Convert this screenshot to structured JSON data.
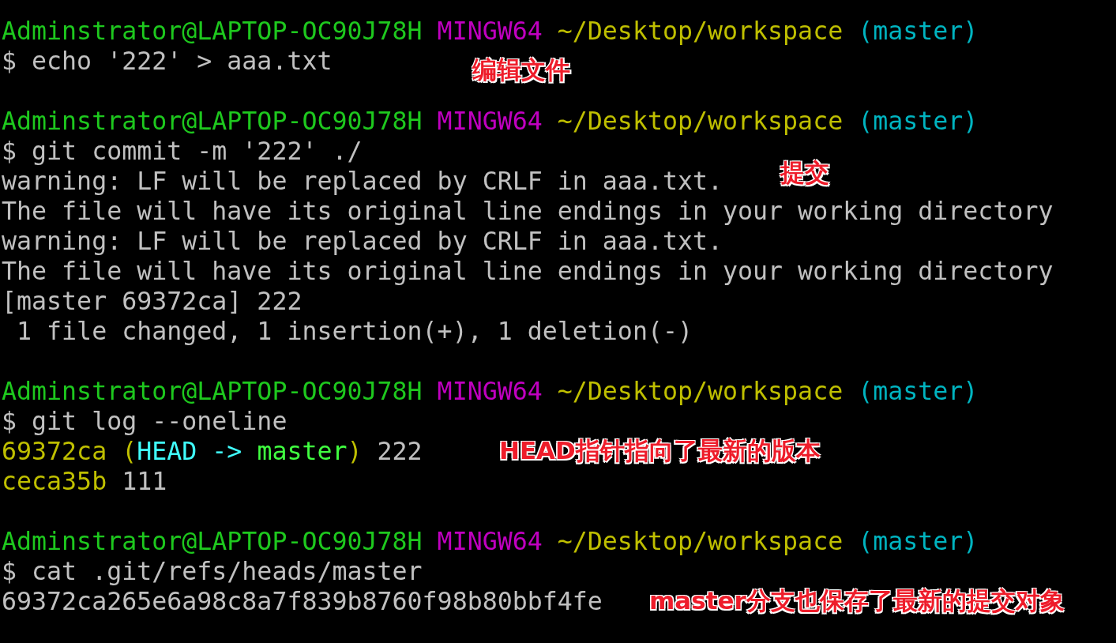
{
  "terminal": {
    "blocks": [
      {
        "lines": [
          {
            "segments": [
              {
                "kind": "user",
                "text": "Adminstrator@LAPTOP-OC90J78H"
              },
              {
                "kind": "host",
                "text": " MINGW64"
              },
              {
                "kind": "path",
                "text": " ~/Desktop/workspace"
              },
              {
                "kind": "branch",
                "text": " (master)"
              }
            ]
          },
          {
            "segments": [
              {
                "kind": "text",
                "text": "$ echo '222' > aaa.txt"
              }
            ],
            "note": "编辑文件"
          }
        ]
      },
      {
        "lines": [
          {
            "segments": [
              {
                "kind": "user",
                "text": "Adminstrator@LAPTOP-OC90J78H"
              },
              {
                "kind": "host",
                "text": " MINGW64"
              },
              {
                "kind": "path",
                "text": " ~/Desktop/workspace"
              },
              {
                "kind": "branch",
                "text": " (master)"
              }
            ]
          },
          {
            "segments": [
              {
                "kind": "text",
                "text": "$ git commit -m '222' ./"
              }
            ]
          },
          {
            "segments": [
              {
                "kind": "text",
                "text": "warning: LF will be replaced by CRLF in aaa.txt."
              }
            ],
            "note": "提交"
          },
          {
            "segments": [
              {
                "kind": "text",
                "text": "The file will have its original line endings in your working directory"
              }
            ]
          },
          {
            "segments": [
              {
                "kind": "text",
                "text": "warning: LF will be replaced by CRLF in aaa.txt."
              }
            ]
          },
          {
            "segments": [
              {
                "kind": "text",
                "text": "The file will have its original line endings in your working directory"
              }
            ]
          },
          {
            "segments": [
              {
                "kind": "text",
                "text": "[master 69372ca] 222"
              }
            ]
          },
          {
            "segments": [
              {
                "kind": "text",
                "text": " 1 file changed, 1 insertion(+), 1 deletion(-)"
              }
            ]
          }
        ]
      },
      {
        "lines": [
          {
            "segments": [
              {
                "kind": "user",
                "text": "Adminstrator@LAPTOP-OC90J78H"
              },
              {
                "kind": "host",
                "text": " MINGW64"
              },
              {
                "kind": "path",
                "text": " ~/Desktop/workspace"
              },
              {
                "kind": "branch",
                "text": " (master)"
              }
            ]
          },
          {
            "segments": [
              {
                "kind": "text",
                "text": "$ git log --oneline"
              }
            ]
          },
          {
            "segments": [
              {
                "kind": "hash",
                "text": "69372ca ("
              },
              {
                "kind": "head",
                "text": "HEAD -> "
              },
              {
                "kind": "ref",
                "text": "master"
              },
              {
                "kind": "hash",
                "text": ")"
              },
              {
                "kind": "text",
                "text": " 222"
              }
            ],
            "note": "HEAD指针指向了最新的版本"
          },
          {
            "segments": [
              {
                "kind": "hash",
                "text": "ceca35b"
              },
              {
                "kind": "text",
                "text": " 111"
              }
            ]
          }
        ]
      },
      {
        "lines": [
          {
            "segments": [
              {
                "kind": "user",
                "text": "Adminstrator@LAPTOP-OC90J78H"
              },
              {
                "kind": "host",
                "text": " MINGW64"
              },
              {
                "kind": "path",
                "text": " ~/Desktop/workspace"
              },
              {
                "kind": "branch",
                "text": " (master)"
              }
            ]
          },
          {
            "segments": [
              {
                "kind": "text",
                "text": "$ cat .git/refs/heads/master"
              }
            ]
          },
          {
            "segments": [
              {
                "kind": "text",
                "text": "69372ca265e6a98c8a7f839b8760f98b80bbf4fe"
              }
            ],
            "note": "master分支也保存了最新的提交对象"
          }
        ]
      }
    ]
  }
}
